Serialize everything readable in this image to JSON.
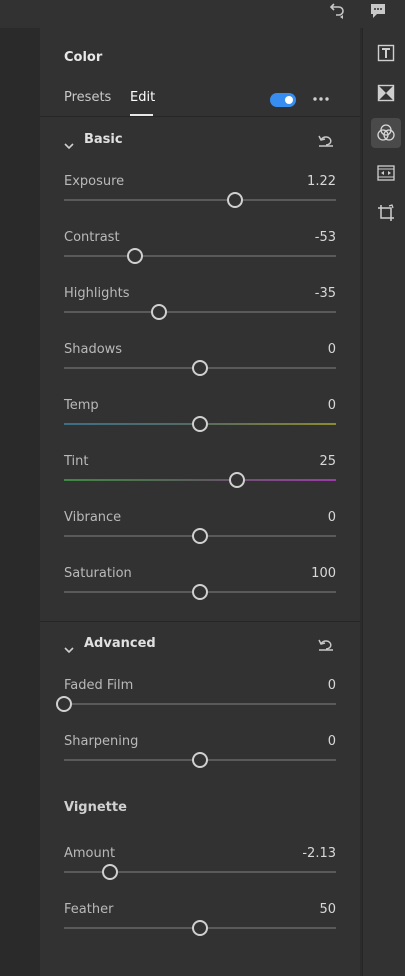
{
  "app": {
    "topbar_icons": [
      "undo-icon",
      "comment-icon"
    ]
  },
  "panel": {
    "title": "Color",
    "tabs": [
      {
        "label": "Presets",
        "active": false
      },
      {
        "label": "Edit",
        "active": true
      }
    ],
    "enabled": true,
    "accent_color": "#378ef0",
    "more_icon": "more-icon"
  },
  "basic": {
    "title": "Basic",
    "sliders": [
      {
        "label": "Exposure",
        "value": "1.22",
        "level": 0.63
      },
      {
        "label": "Contrast",
        "value": "-53",
        "level": 0.26
      },
      {
        "label": "Highlights",
        "value": "-35",
        "level": 0.35
      },
      {
        "label": "Shadows",
        "value": "0",
        "level": 0.5
      },
      {
        "label": "Temp",
        "value": "0",
        "level": 0.5
      },
      {
        "label": "Tint",
        "value": "25",
        "level": 0.635
      },
      {
        "label": "Vibrance",
        "value": "0",
        "level": 0.5
      },
      {
        "label": "Saturation",
        "value": "100",
        "level": 0.5
      }
    ]
  },
  "advanced": {
    "title": "Advanced",
    "sliders": [
      {
        "label": "Faded Film",
        "value": "0",
        "level": 0.0
      },
      {
        "label": "Sharpening",
        "value": "0",
        "level": 0.5
      }
    ],
    "vignette": {
      "title": "Vignette",
      "sliders": [
        {
          "label": "Amount",
          "value": "-2.13",
          "level": 0.17
        },
        {
          "label": "Feather",
          "value": "50",
          "level": 0.5
        }
      ]
    }
  },
  "toolbar": {
    "tools": [
      {
        "name": "text-tool-icon",
        "active": false
      },
      {
        "name": "mask-tool-icon",
        "active": false
      },
      {
        "name": "color-tool-icon",
        "active": true
      },
      {
        "name": "filmstrip-tool-icon",
        "active": false
      },
      {
        "name": "crop-tool-icon",
        "active": false
      }
    ]
  }
}
